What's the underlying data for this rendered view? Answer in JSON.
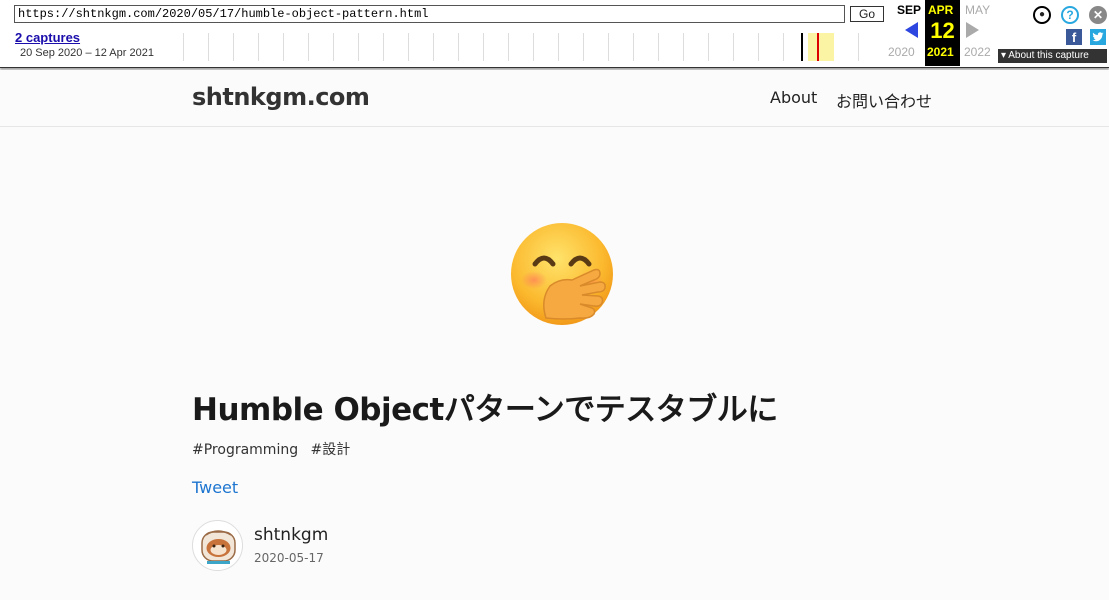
{
  "wayback": {
    "url": "https://shtnkgm.com/2020/05/17/humble-object-pattern.html",
    "go_label": "Go",
    "captures_link": "2 captures",
    "date_range": "20 Sep 2020 – 12 Apr 2021",
    "prev_month": "SEP",
    "current_month": "APR",
    "next_month": "MAY",
    "current_day": "12",
    "prev_year": "2020",
    "current_year": "2021",
    "next_year": "2022",
    "about_label": "▾ About this capture"
  },
  "header": {
    "brand": "shtnkgm.com",
    "nav": [
      {
        "label": "About"
      },
      {
        "label": "お問い合わせ"
      }
    ]
  },
  "article": {
    "hero_emoji": "face-with-hand-over-mouth",
    "title": "Humble Objectパターンでテスタブルに",
    "tags": [
      "#Programming",
      "#設計"
    ],
    "tweet_label": "Tweet",
    "author": "shtnkgm",
    "date": "2020-05-17"
  }
}
